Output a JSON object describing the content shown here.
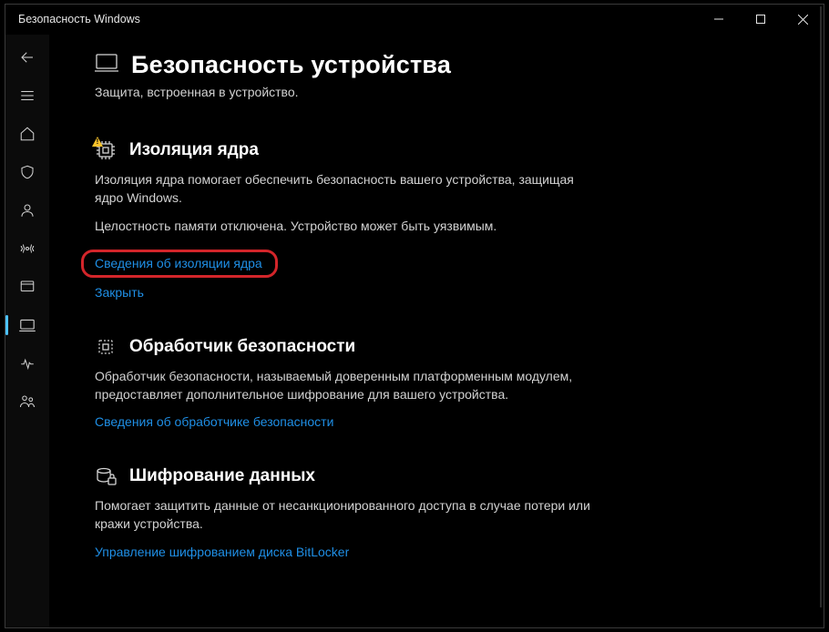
{
  "app_title": "Безопасность Windows",
  "page": {
    "title": "Безопасность устройства",
    "subtitle": "Защита, встроенная в устройство."
  },
  "sections": {
    "core_isolation": {
      "heading": "Изоляция ядра",
      "body": "Изоляция ядра помогает обеспечить безопасность вашего устройства, защищая ядро Windows.",
      "warning": "Целостность памяти отключена. Устройство может быть уязвимым.",
      "link_details": "Сведения об изоляции ядра",
      "link_close": "Закрыть"
    },
    "security_processor": {
      "heading": "Обработчик безопасности",
      "body": "Обработчик безопасности, называемый доверенным платформенным модулем, предоставляет дополнительное шифрование для вашего устройства.",
      "link_details": "Сведения об обработчике безопасности"
    },
    "data_encryption": {
      "heading": "Шифрование данных",
      "body": "Помогает защитить данные от несанкционированного доступа в случае потери или кражи устройства.",
      "link_manage": "Управление шифрованием диска BitLocker"
    }
  }
}
